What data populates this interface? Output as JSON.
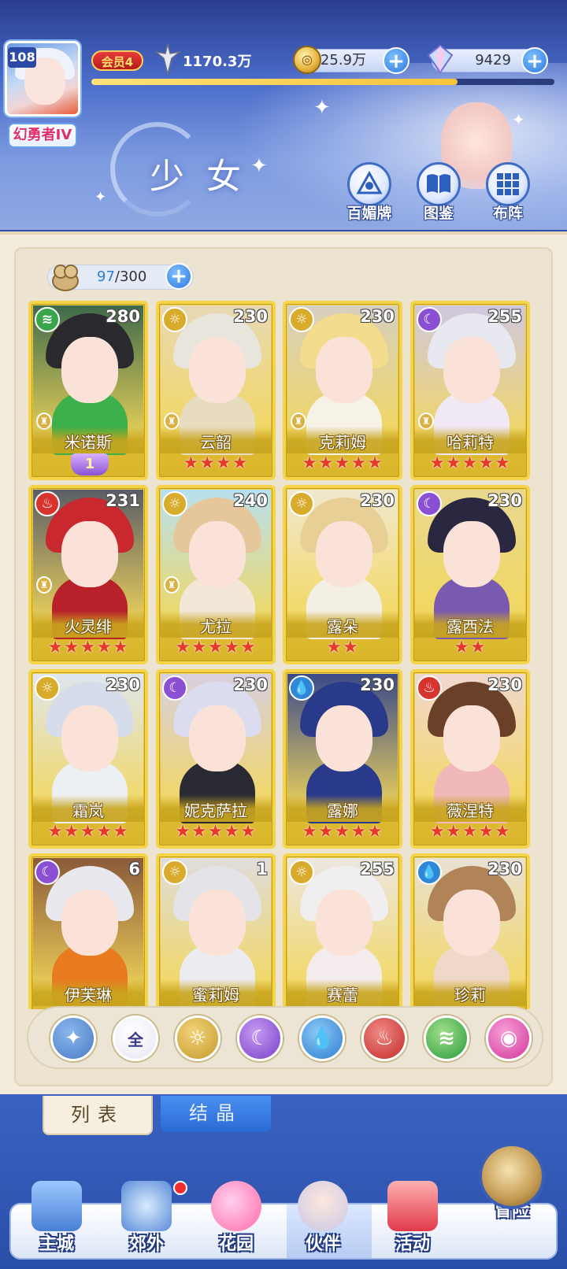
{
  "player": {
    "level": "108",
    "rank_title": "幻勇者IV",
    "vip": "会员4",
    "power": "1170.3万"
  },
  "resources": {
    "coins": "25.9万",
    "gems": "9429",
    "coin_icon": "gold-coin-icon",
    "gem_icon": "crystal-icon"
  },
  "page": {
    "title": "少女",
    "header_buttons": [
      {
        "label": "百媚牌",
        "icon": "card-deck-icon"
      },
      {
        "label": "图鉴",
        "icon": "book-icon"
      },
      {
        "label": "布阵",
        "icon": "grid-icon"
      }
    ]
  },
  "roster": {
    "current": "97",
    "sep": "/300"
  },
  "characters": [
    {
      "name": "米诺斯",
      "level": "280",
      "element": "wind",
      "stars": "",
      "awaken": "1",
      "role": true
    },
    {
      "name": "云韶",
      "level": "230",
      "element": "light",
      "stars": "★★★★",
      "awaken": "",
      "role": true
    },
    {
      "name": "克莉姆",
      "level": "230",
      "element": "light",
      "stars": "★★★★★",
      "awaken": "",
      "role": true
    },
    {
      "name": "哈莉特",
      "level": "255",
      "element": "dark",
      "stars": "★★★★★",
      "awaken": "",
      "role": true
    },
    {
      "name": "火灵绯",
      "level": "231",
      "element": "fire",
      "stars": "★★★★★",
      "awaken": "",
      "role": true
    },
    {
      "name": "尤拉",
      "level": "240",
      "element": "light",
      "stars": "★★★★★",
      "awaken": "",
      "role": true
    },
    {
      "name": "露朵",
      "level": "230",
      "element": "light",
      "stars": "★★",
      "awaken": "",
      "role": false
    },
    {
      "name": "露西法",
      "level": "230",
      "element": "dark",
      "stars": "★★",
      "awaken": "",
      "role": false
    },
    {
      "name": "霜岚",
      "level": "230",
      "element": "light",
      "stars": "★★★★★",
      "awaken": "",
      "role": false
    },
    {
      "name": "妮克萨拉",
      "level": "230",
      "element": "dark",
      "stars": "★★★★★",
      "awaken": "",
      "role": false
    },
    {
      "name": "露娜",
      "level": "230",
      "element": "water",
      "stars": "★★★★★",
      "awaken": "",
      "role": false
    },
    {
      "name": "薇涅特",
      "level": "230",
      "element": "fire",
      "stars": "★★★★★",
      "awaken": "",
      "role": false
    },
    {
      "name": "伊芙琳",
      "level": "6",
      "element": "dark",
      "stars": "",
      "awaken": "",
      "role": false
    },
    {
      "name": "蜜莉姆",
      "level": "1",
      "element": "light",
      "stars": "",
      "awaken": "",
      "role": false
    },
    {
      "name": "赛蕾",
      "level": "255",
      "element": "light",
      "stars": "",
      "awaken": "",
      "role": false
    },
    {
      "name": "珍莉",
      "level": "230",
      "element": "water",
      "stars": "",
      "awaken": "",
      "role": false
    }
  ],
  "filters": [
    {
      "icon": "wing-icon",
      "label": ""
    },
    {
      "icon": "all-icon",
      "label": "全"
    },
    {
      "icon": "sun-icon",
      "label": ""
    },
    {
      "icon": "moon-icon",
      "label": ""
    },
    {
      "icon": "water-drop-icon",
      "label": ""
    },
    {
      "icon": "fire-icon",
      "label": ""
    },
    {
      "icon": "wind-icon",
      "label": ""
    },
    {
      "icon": "star-orb-icon",
      "label": ""
    }
  ],
  "tabs": {
    "list": "列表",
    "crystal": "结晶"
  },
  "nav": [
    {
      "label": "主城",
      "icon": "castle-icon"
    },
    {
      "label": "郊外",
      "icon": "portal-icon"
    },
    {
      "label": "花园",
      "icon": "heart-icon"
    },
    {
      "label": "伙伴",
      "icon": "partner-icon"
    },
    {
      "label": "活动",
      "icon": "gift-icon"
    },
    {
      "label": "冒险",
      "icon": "compass-icon"
    }
  ],
  "colors": {
    "card_gold": "#f2d64a",
    "light": "#d8ab2c",
    "dark": "#8a4fd2",
    "fire": "#d8342e",
    "water": "#2f87d8",
    "wind": "#3aa64c"
  }
}
